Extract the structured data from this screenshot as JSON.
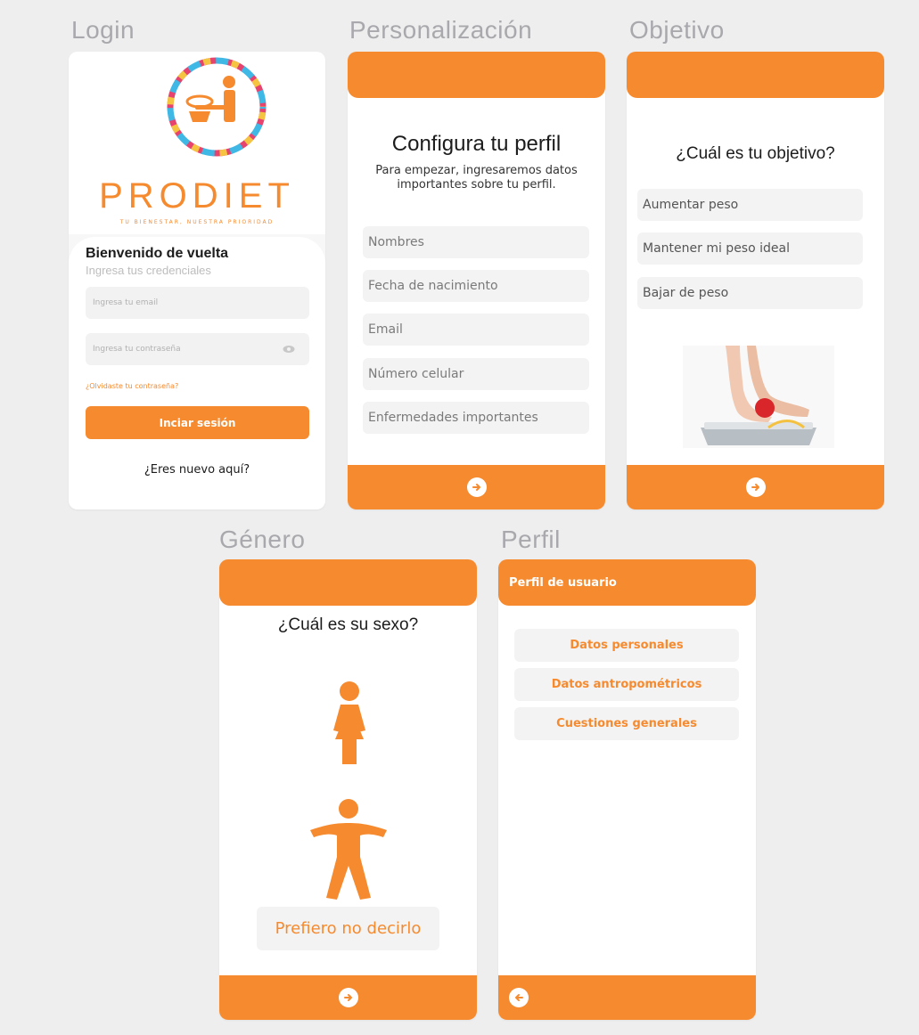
{
  "sections": {
    "login": "Login",
    "personalizacion": "Personalización",
    "objetivo": "Objetivo",
    "genero": "Género",
    "perfil": "Perfil"
  },
  "login": {
    "brand": "PRODIET",
    "tagline": "TU BIENESTAR, NUESTRA PRIORIDAD",
    "welcome": "Bienvenido de vuelta",
    "subtitle": "Ingresa tus credenciales",
    "email_placeholder": "Ingresa tu email",
    "password_placeholder": "Ingresa tu contraseña",
    "forgot": "¿Olvidaste tu contraseña?",
    "login_button": "Inciar sesión",
    "new_here": "¿Eres nuevo aquí?"
  },
  "personalizacion": {
    "title": "Configura tu perfil",
    "description": "Para empezar, ingresaremos datos importantes sobre tu perfil.",
    "fields": [
      "Nombres",
      "Fecha de nacimiento",
      "Email",
      "Número celular",
      "Enfermedades importantes"
    ]
  },
  "objetivo": {
    "title": "¿Cuál es tu objetivo?",
    "options": [
      "Aumentar peso",
      "Mantener mi peso ideal",
      "Bajar de peso"
    ]
  },
  "genero": {
    "title": "¿Cuál es su sexo?",
    "prefer_not": "Prefiero no decirlo"
  },
  "perfil": {
    "header": "Perfil de usuario",
    "items": [
      "Datos personales",
      "Datos antropométricos",
      "Cuestiones generales"
    ]
  },
  "colors": {
    "accent": "#f68a2e",
    "field_bg": "#f3f3f4",
    "background": "#eeeeef"
  },
  "icons": {
    "next": "arrow-right-icon",
    "back": "arrow-left-icon",
    "eye": "eye-icon",
    "female": "female-figure-icon",
    "male": "male-figure-icon"
  }
}
